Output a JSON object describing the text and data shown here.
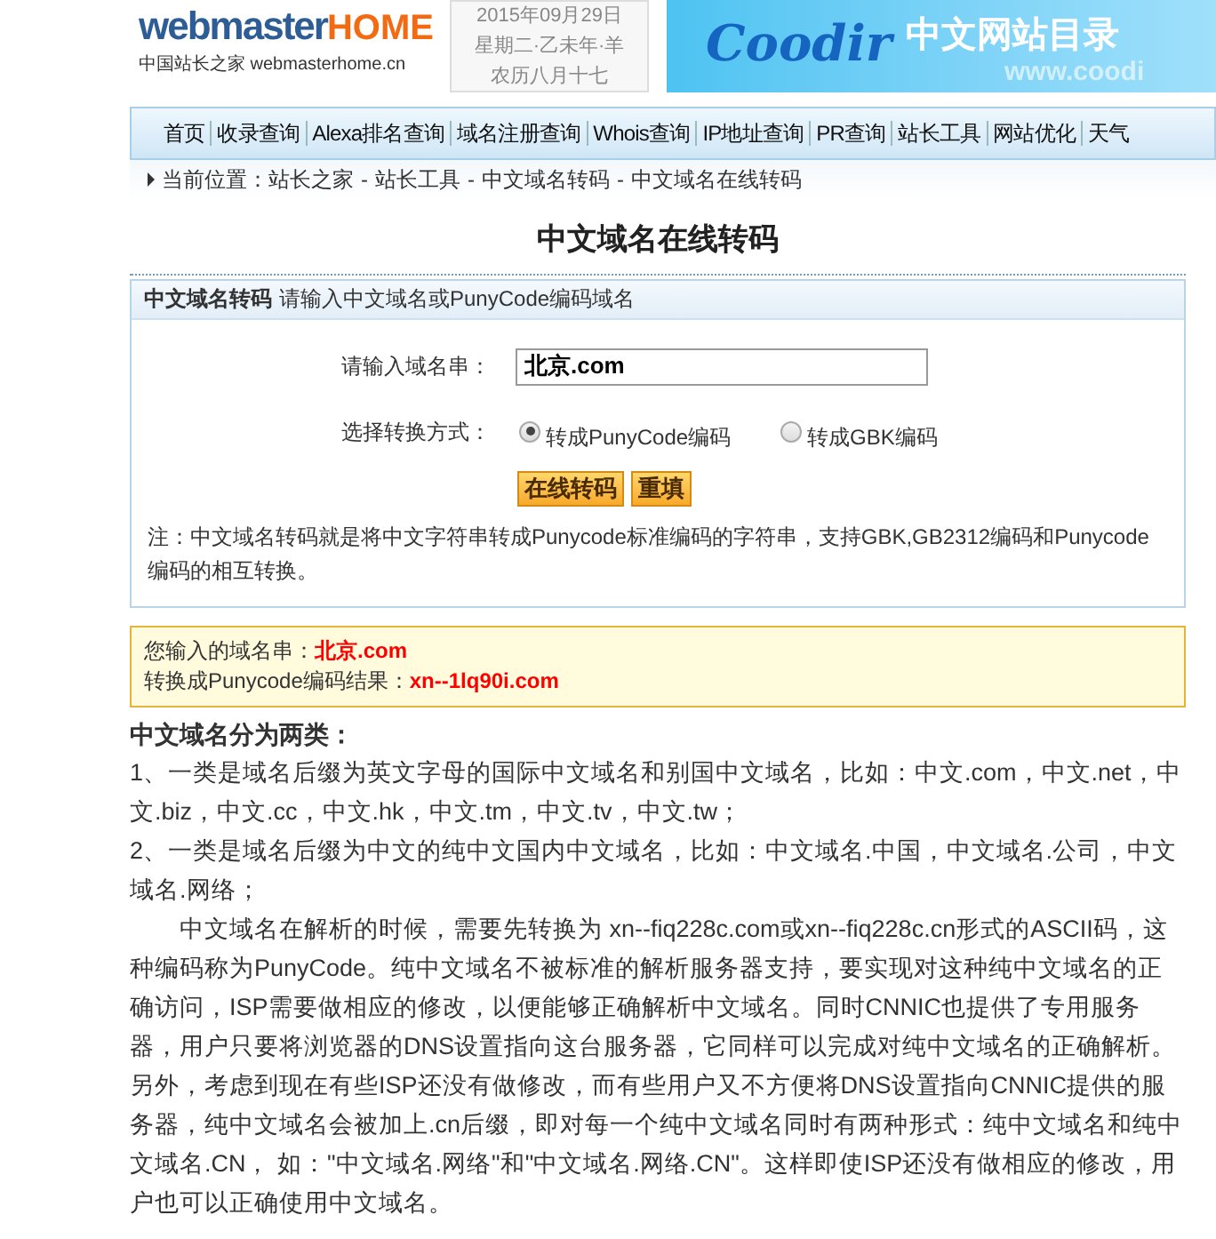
{
  "header": {
    "logo": {
      "brand_main": "webmaster",
      "brand_accent": "HOME",
      "tagline": "中国站长之家 webmasterhome.cn"
    },
    "date_box": [
      "2015年09月29日",
      "星期二·乙未年·羊",
      "农历八月十七"
    ],
    "banner": {
      "brand": "Coodir",
      "title": "中文网站目录",
      "faint_text": "www.coodi"
    }
  },
  "nav": [
    "首页",
    "收录查询",
    "Alexa排名查询",
    "域名注册查询",
    "Whois查询",
    "IP地址查询",
    "PR查询",
    "站长工具",
    "网站优化",
    "天气"
  ],
  "breadcrumb": {
    "label": "当前位置：",
    "separator": "-",
    "items": [
      "站长之家",
      "站长工具",
      "中文域名转码",
      "中文域名在线转码"
    ]
  },
  "page_title": "中文域名在线转码",
  "form_panel": {
    "heading_bold": "中文域名转码",
    "heading_text": "请输入中文域名或PunyCode编码域名",
    "input_label": "请输入域名串：",
    "input_value": "北京.com",
    "mode_label": "选择转换方式：",
    "options": [
      {
        "label": "转成PunyCode编码",
        "selected": true
      },
      {
        "label": "转成GBK编码",
        "selected": false
      }
    ],
    "buttons": [
      "在线转码",
      "重填"
    ],
    "note": "注：中文域名转码就是将中文字符串转成Punycode标准编码的字符串，支持GBK,GB2312编码和Punycode编码的相互转换。"
  },
  "result": [
    {
      "label": "您输入的域名串：",
      "value": "北京.com"
    },
    {
      "label": "转换成Punycode编码结果：",
      "value": "xn--1lq90i.com"
    }
  ],
  "article": {
    "heading": "中文域名分为两类：",
    "paragraphs": [
      {
        "kind": "item",
        "text": "1、一类是域名后缀为英文字母的国际中文域名和别国中文域名，比如：中文.com，中文.net，中文.biz，中文.cc，中文.hk，中文.tm，中文.tv，中文.tw；"
      },
      {
        "kind": "item",
        "text": "2、一类是域名后缀为中文的纯中文国内中文域名，比如：中文域名.中国，中文域名.公司，中文域名.网络；"
      },
      {
        "kind": "indented",
        "text": "中文域名在解析的时候，需要先转换为 xn--fiq228c.com或xn--fiq228c.cn形式的ASCII码，这种编码称为PunyCode。纯中文域名不被标准的解析服务器支持，要实现对这种纯中文域名的正确访问，ISP需要做相应的修改，以便能够正确解析中文域名。同时CNNIC也提供了专用服务器，用户只要将浏览器的DNS设置指向这台服务器，它同样可以完成对纯中文域名的正确解析。另外，考虑到现在有些ISP还没有做修改，而有些用户又不方便将DNS设置指向CNNIC提供的服务器，纯中文域名会被加上.cn后缀，即对每一个纯中文域名同时有两种形式：纯中文域名和纯中文域名.CN， 如：\"中文域名.网络\"和\"中文域名.网络.CN\"。这样即使ISP还没有做相应的修改，用户也可以正确使用中文域名。"
      }
    ]
  }
}
